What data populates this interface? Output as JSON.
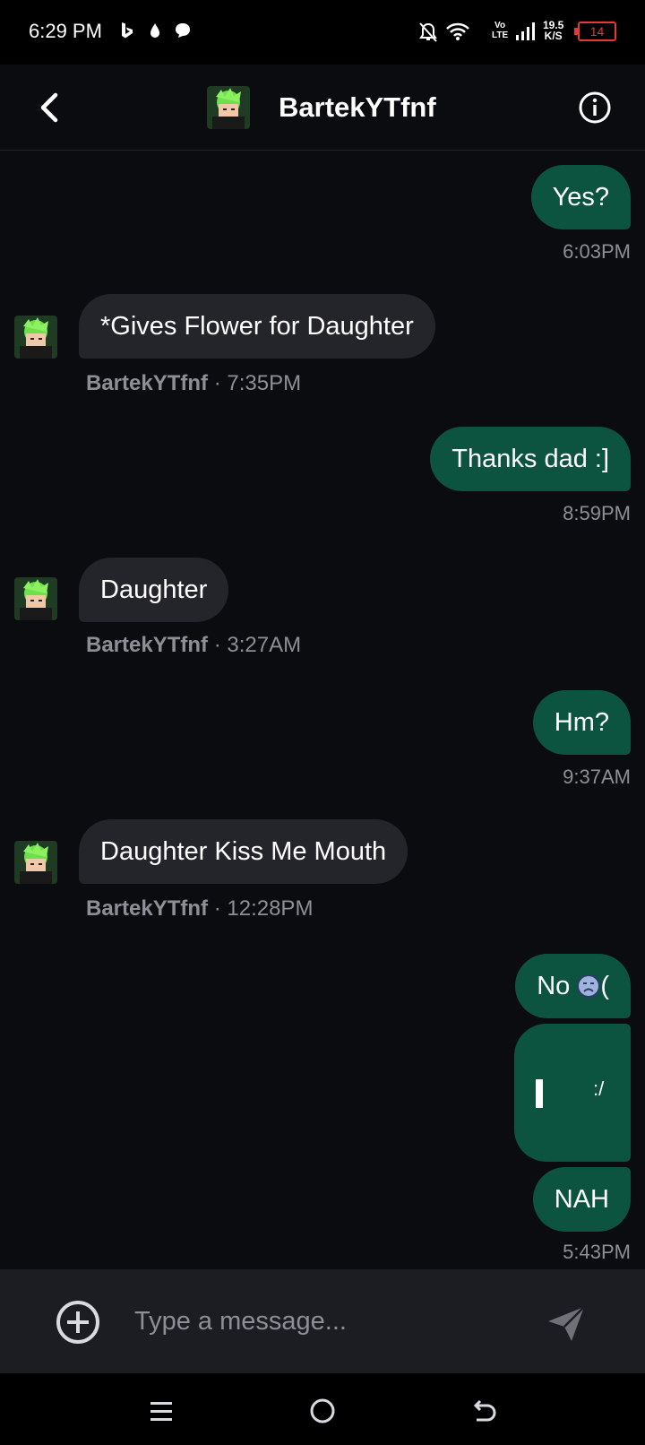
{
  "status_bar": {
    "time": "6:29 PM",
    "volte_top": "Vo",
    "volte_bottom": "LTE",
    "speed_value": "19.5",
    "speed_unit": "K/S",
    "battery": "14"
  },
  "header": {
    "title": "BartekYTfnf"
  },
  "messages": [
    {
      "direction": "outgoing",
      "text": "Yes?",
      "time": "6:03PM"
    },
    {
      "direction": "incoming",
      "text": "*Gives Flower for Daughter",
      "sender": "BartekYTfnf",
      "separator": "·",
      "time": "7:35PM"
    },
    {
      "direction": "outgoing",
      "text": "Thanks dad :]",
      "time": "8:59PM"
    },
    {
      "direction": "incoming",
      "text": "Daughter",
      "sender": "BartekYTfnf",
      "separator": "·",
      "time": "3:27AM"
    },
    {
      "direction": "outgoing",
      "text": "Hm?",
      "time": "9:37AM"
    },
    {
      "direction": "incoming",
      "text": "Daughter Kiss Me Mouth",
      "sender": "BartekYTfnf",
      "separator": "·",
      "time": "12:28PM"
    },
    {
      "direction": "outgoing",
      "text": "No",
      "suffix": "("
    },
    {
      "direction": "outgoing",
      "text": ":/"
    },
    {
      "direction": "outgoing",
      "text": "NAH",
      "time": "5:43PM"
    }
  ],
  "composer": {
    "placeholder": "Type a message..."
  },
  "icons": {
    "back": "chevron-left-icon",
    "info": "info-icon",
    "add": "plus-circle-icon",
    "send": "send-icon",
    "nav_menu": "menu-icon",
    "nav_home": "home-icon",
    "nav_back": "back-icon"
  },
  "colors": {
    "background": "#0b0c10",
    "outgoing_bubble": "#0d5440",
    "incoming_bubble": "#24252b",
    "muted_text": "#8d8f96",
    "composer": "#1c1d22",
    "battery_low": "#e53935"
  }
}
